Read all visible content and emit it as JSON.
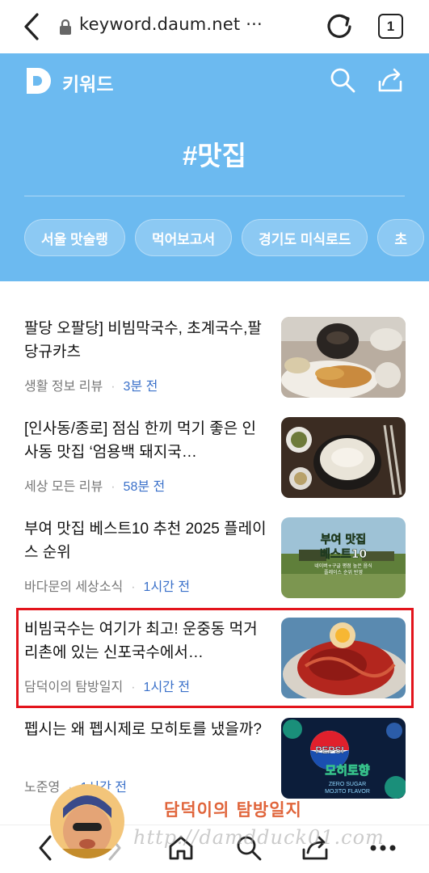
{
  "browser": {
    "url": "keyword.daum.net ···",
    "tab_count": "1"
  },
  "header": {
    "logo_label": "키워드",
    "hashtag": "#맛집",
    "chips": [
      "서울 맛술랭",
      "먹어보고서",
      "경기도 미식로드",
      "초"
    ]
  },
  "articles": [
    {
      "title": "팔당 오팔당] 비빔막국수, 초계국수,팔당규카츠",
      "source": "생활 정보 리뷰",
      "time": "3분 전"
    },
    {
      "title": "[인사동/종로] 점심 한끼 먹기 좋은 인사동 맛집 ‘엄용백 돼지국…",
      "source": "세상 모든 리뷰",
      "time": "58분 전"
    },
    {
      "title": "부여 맛집 베스트10 추천 2025 플레이스 순위",
      "source": "바다문의 세상소식",
      "time": "1시간 전",
      "thumb_text": [
        "부여 맛집",
        "베스트10",
        "네이버+구글 평점 높은 음식",
        "플레이스 순위 반영"
      ]
    },
    {
      "title": "비빔국수는 여기가 최고! 운중동 먹거리촌에 있는 신포국수에서…",
      "source": "담덕이의 탐방일지",
      "time": "1시간 전"
    },
    {
      "title": "펩시는 왜 펩시제로 모히토를 냈을까?",
      "source": "노준영",
      "time": "1시간 전",
      "thumb_text": [
        "PEPSI",
        "모히토향",
        "ZERO SUGAR",
        "MOJITO FLAVOR"
      ]
    }
  ],
  "watermark": {
    "text": "담덕이의 탐방일지",
    "url": "http://damdduck01.com"
  },
  "colors": {
    "header_blue": "#6cbaf0",
    "time_blue": "#3a70c9",
    "highlight_red": "#e3141c"
  },
  "icons": [
    "back-icon",
    "lock-icon",
    "reload-icon",
    "tabs-icon",
    "daum-logo",
    "search-icon",
    "share-icon",
    "home-icon",
    "menu-icon"
  ]
}
